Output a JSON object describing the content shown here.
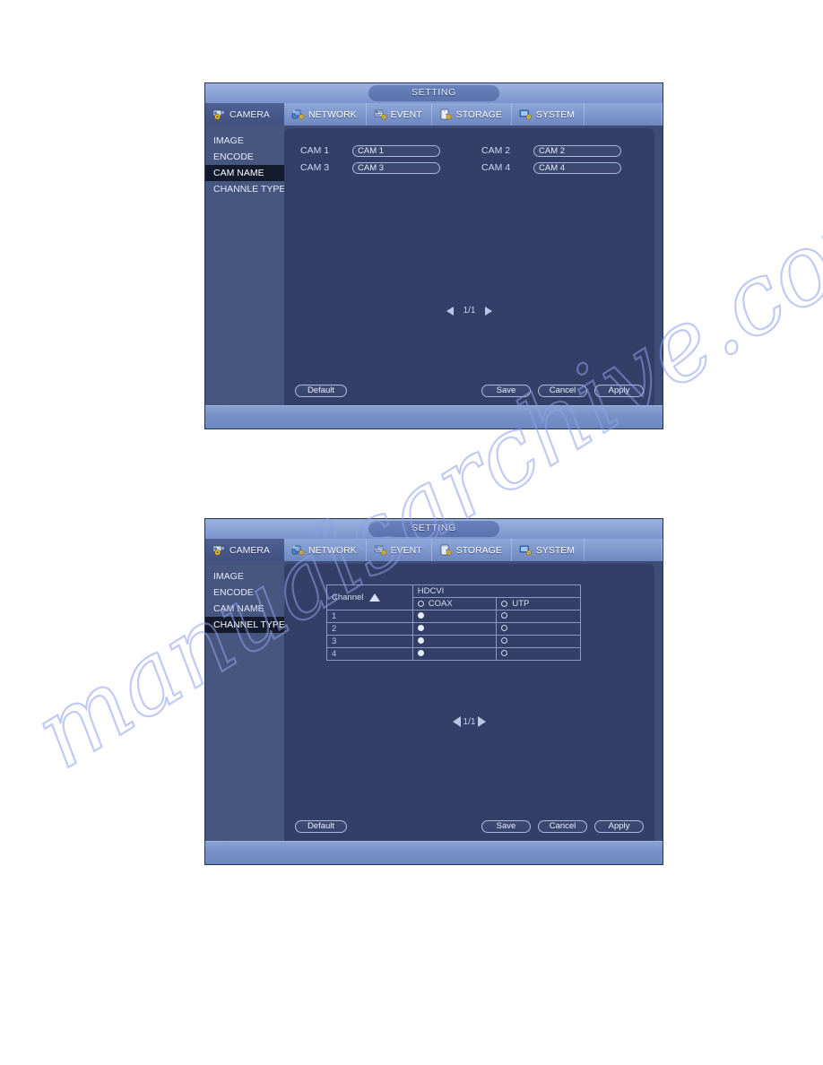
{
  "watermark": {
    "text": "manualsarchive.com"
  },
  "panels": [
    {
      "id": "cam-name-panel",
      "title": "SETTING",
      "tabs": [
        {
          "label": "CAMERA",
          "icon": "camera-gear-icon",
          "active": true
        },
        {
          "label": "NETWORK",
          "icon": "network-gear-icon",
          "active": false
        },
        {
          "label": "EVENT",
          "icon": "event-gear-icon",
          "active": false
        },
        {
          "label": "STORAGE",
          "icon": "storage-gear-icon",
          "active": false
        },
        {
          "label": "SYSTEM",
          "icon": "system-gear-icon",
          "active": false
        }
      ],
      "sidebar": [
        {
          "label": "IMAGE",
          "active": false
        },
        {
          "label": "ENCODE",
          "active": false
        },
        {
          "label": "CAM NAME",
          "active": true
        },
        {
          "label": "CHANNLE TYPE",
          "active": false
        }
      ],
      "cam_names": [
        {
          "label": "CAM 1",
          "value": "CAM 1"
        },
        {
          "label": "CAM 2",
          "value": "CAM 2"
        },
        {
          "label": "CAM 3",
          "value": "CAM 3"
        },
        {
          "label": "CAM 4",
          "value": "CAM 4"
        }
      ],
      "pagination": {
        "current": "1/1",
        "prev": "◀",
        "next": "▶"
      },
      "buttons": {
        "default": "Default",
        "save": "Save",
        "cancel": "Cancel",
        "apply": "Apply"
      }
    },
    {
      "id": "channel-type-panel",
      "title": "SETTING",
      "tabs": [
        {
          "label": "CAMERA",
          "icon": "camera-gear-icon",
          "active": true
        },
        {
          "label": "NETWORK",
          "icon": "network-gear-icon",
          "active": false
        },
        {
          "label": "EVENT",
          "icon": "event-gear-icon",
          "active": false
        },
        {
          "label": "STORAGE",
          "icon": "storage-gear-icon",
          "active": false
        },
        {
          "label": "SYSTEM",
          "icon": "system-gear-icon",
          "active": false
        }
      ],
      "sidebar": [
        {
          "label": "IMAGE",
          "active": false
        },
        {
          "label": "ENCODE",
          "active": false
        },
        {
          "label": "CAM NAME",
          "active": false
        },
        {
          "label": "CHANNEL TYPE",
          "active": true
        }
      ],
      "table": {
        "channel_header": "Channel",
        "sort_direction": "ascending",
        "group_header": "HDCVI",
        "type_headers": [
          {
            "label": "COAX",
            "selected": false
          },
          {
            "label": "UTP",
            "selected": false
          }
        ],
        "rows": [
          {
            "channel": "1",
            "coax": true,
            "utp": false
          },
          {
            "channel": "2",
            "coax": true,
            "utp": false
          },
          {
            "channel": "3",
            "coax": true,
            "utp": false
          },
          {
            "channel": "4",
            "coax": true,
            "utp": false
          }
        ]
      },
      "pagination": {
        "current": "1/1",
        "prev": "◀",
        "next": "▶"
      },
      "buttons": {
        "default": "Default",
        "save": "Save",
        "cancel": "Cancel",
        "apply": "Apply"
      }
    }
  ],
  "colors": {
    "window_bg": "#3e4d78",
    "content_bg": "#333f66",
    "sidebar_bg": "#47567f",
    "sidebar_active_bg": "#131a2e",
    "tab_active_bg": "#4f6095",
    "titlebar_grad_top": "#9db2dd",
    "accent_text": "#e6ecfb"
  }
}
